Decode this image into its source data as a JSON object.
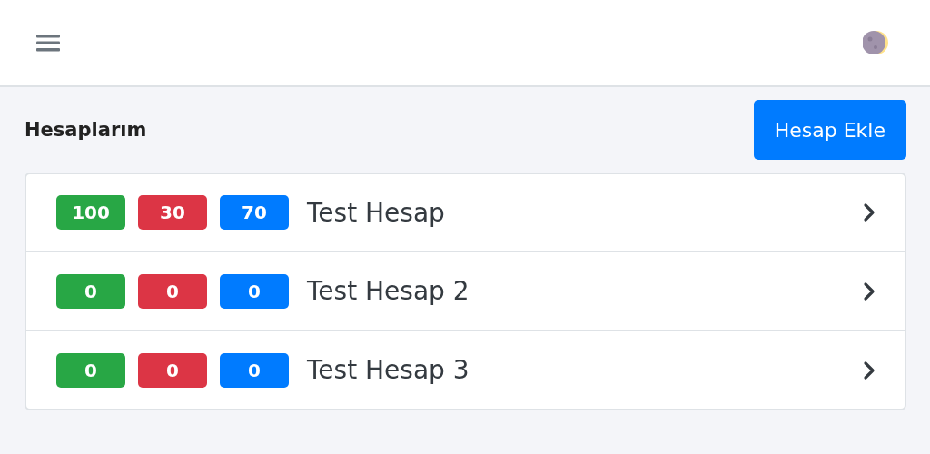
{
  "header": {
    "title": "Hesaplarım",
    "add_button": "Hesap Ekle"
  },
  "accounts": [
    {
      "name": "Test Hesap",
      "badges": [
        {
          "text": "100",
          "color": "#28a745"
        },
        {
          "text": "30",
          "color": "#dc3545"
        },
        {
          "text": "70",
          "color": "#007bff"
        }
      ]
    },
    {
      "name": "Test Hesap 2",
      "badges": [
        {
          "text": "0",
          "color": "#28a745"
        },
        {
          "text": "0",
          "color": "#dc3545"
        },
        {
          "text": "0",
          "color": "#007bff"
        }
      ]
    },
    {
      "name": "Test Hesap 3",
      "badges": [
        {
          "text": "0",
          "color": "#28a745"
        },
        {
          "text": "0",
          "color": "#dc3545"
        },
        {
          "text": "0",
          "color": "#007bff"
        }
      ]
    }
  ]
}
